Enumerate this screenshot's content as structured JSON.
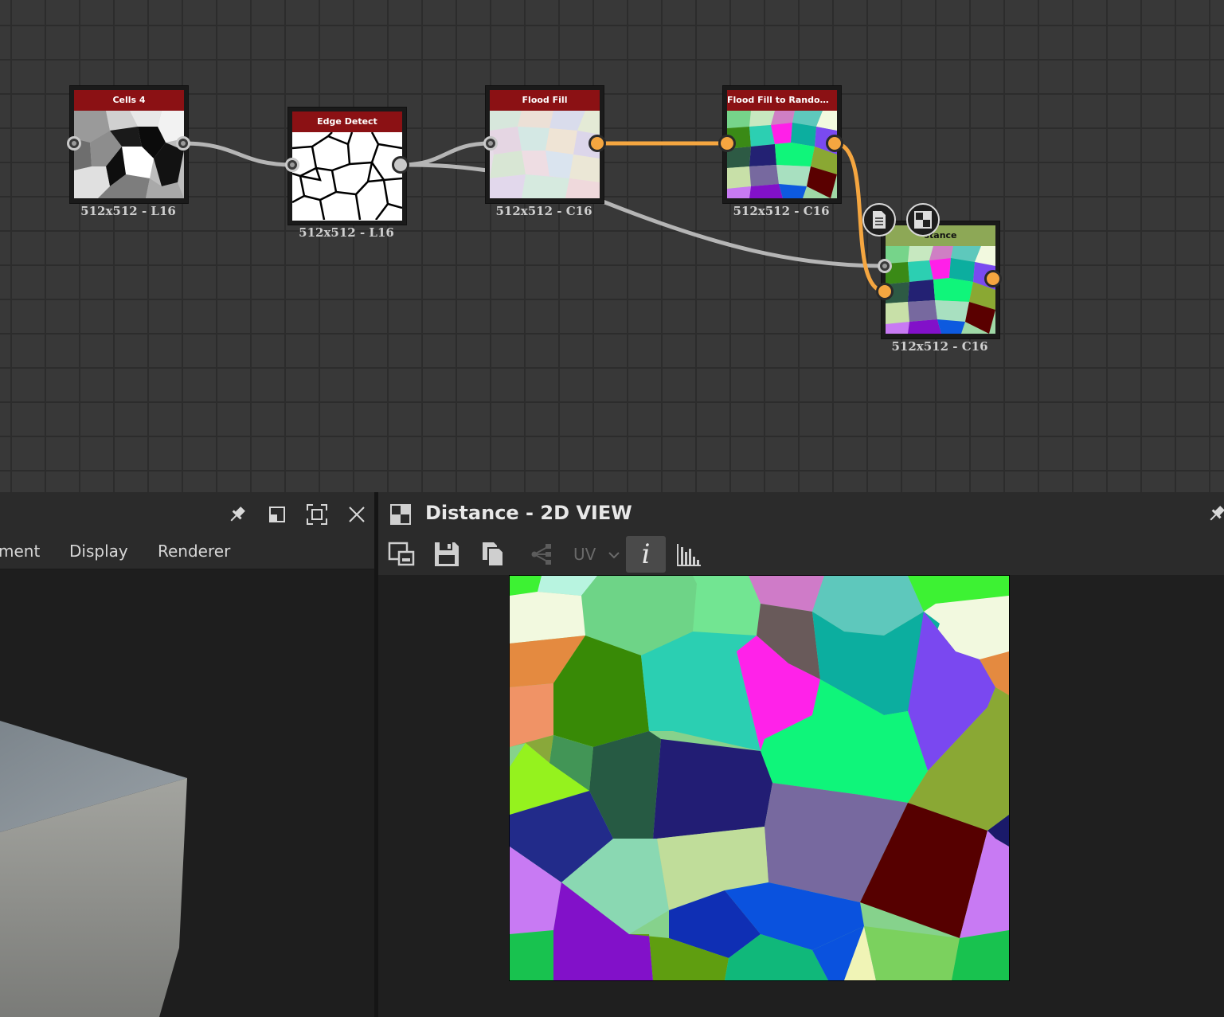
{
  "graph": {
    "nodes": [
      {
        "title": "Cells 4",
        "label": "512x512 - L16"
      },
      {
        "title": "Edge Detect",
        "label": "512x512 - L16"
      },
      {
        "title": "Flood Fill",
        "label": "512x512 - C16"
      },
      {
        "title": "Flood Fill to Random C...",
        "label": "512x512 - C16"
      },
      {
        "title": "stance",
        "label": "512x512 - C16"
      }
    ],
    "wire_colors": {
      "gray": "#b5b5b5",
      "orange": "#f5a640"
    },
    "node_title_color": "#8b1114"
  },
  "left_panel": {
    "menu": [
      "ment",
      "Display",
      "Renderer"
    ],
    "header_icons": [
      "pin-icon",
      "restore-icon",
      "maximize-icon",
      "close-icon"
    ]
  },
  "view2d": {
    "title": "Distance - 2D VIEW",
    "toolbar": {
      "icons": [
        "export-image-icon",
        "save-icon",
        "copy-icon",
        "graph-icon",
        "info-icon",
        "histogram-icon"
      ],
      "uv_label": "UV",
      "info_label": "i"
    }
  }
}
